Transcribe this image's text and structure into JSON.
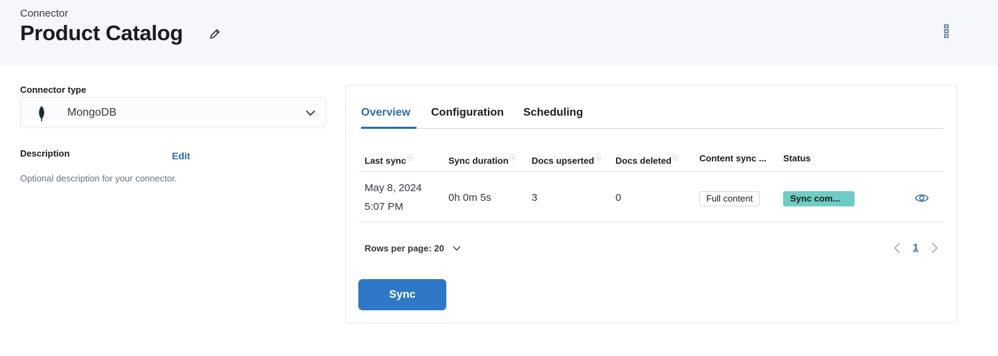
{
  "header": {
    "eyebrow": "Connector",
    "title": "Product Catalog",
    "icons": {
      "edit": "pencil-icon",
      "more": "more-vertical-icon"
    }
  },
  "left": {
    "connector_type_label": "Connector type",
    "connector_type_value": "MongoDB",
    "connector_type_icon": "mongodb-leaf-icon",
    "description_label": "Description",
    "description_edit": "Edit",
    "description_text": "Optional description for your connector."
  },
  "tabs": [
    {
      "label": "Overview",
      "active": true
    },
    {
      "label": "Configuration",
      "active": false
    },
    {
      "label": "Scheduling",
      "active": false
    }
  ],
  "table": {
    "columns": [
      "Last sync",
      "Sync duration",
      "Docs upserted",
      "Docs deleted",
      "Content sync ...",
      "Status"
    ],
    "rows": [
      {
        "last_sync_date": "May 8, 2024",
        "last_sync_time": "5:07 PM",
        "duration": "0h 0m 5s",
        "docs_upserted": "3",
        "docs_deleted": "0",
        "content_sync": "Full content",
        "status": "Sync com...",
        "action_icon": "eye-icon"
      }
    ]
  },
  "pagination": {
    "rows_per_page": "Rows per page: 20",
    "current_page": "1"
  },
  "actions": {
    "sync_label": "Sync"
  },
  "colors": {
    "accent": "#2f6ea4",
    "button": "#2f78c7",
    "status_success": "#6dccc5"
  }
}
